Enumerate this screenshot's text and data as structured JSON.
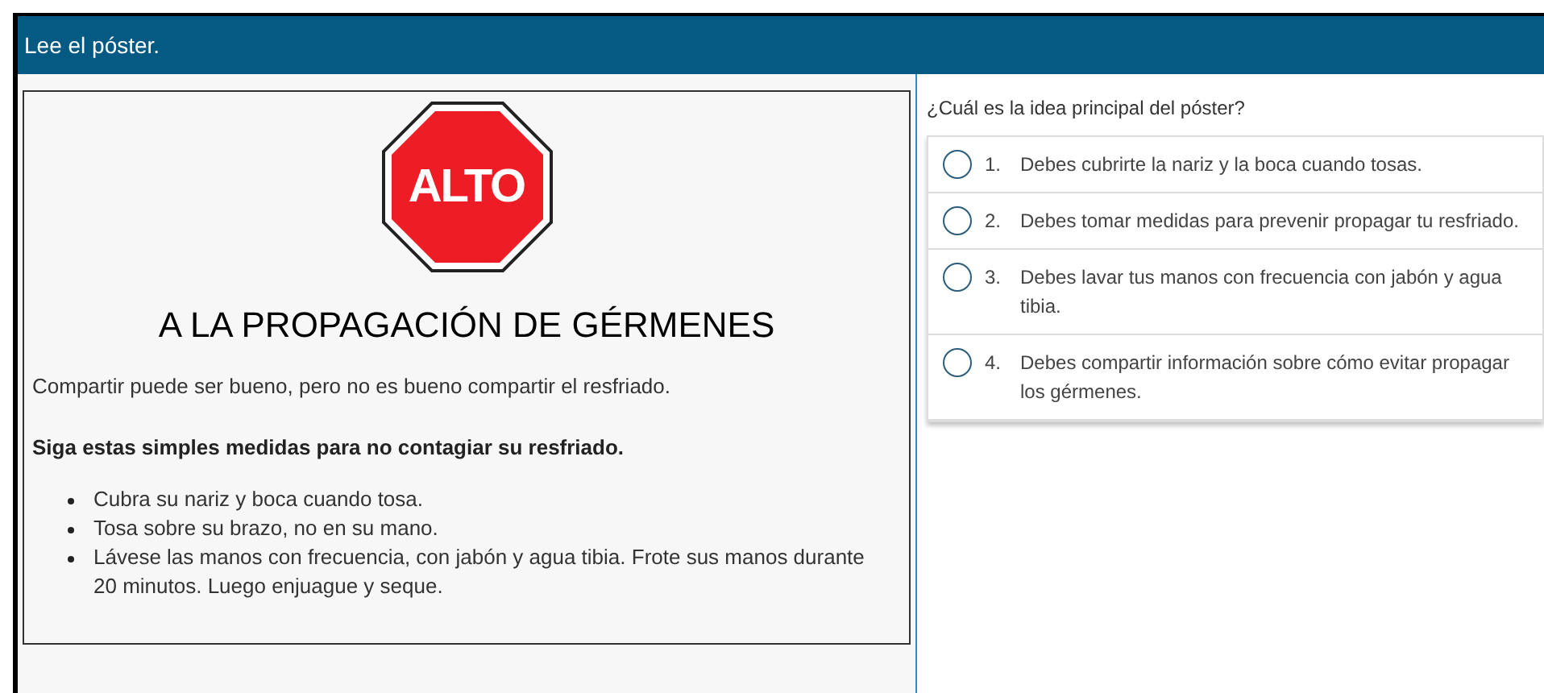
{
  "header": {
    "title": "Lee el póster."
  },
  "poster": {
    "sign_text": "ALTO",
    "heading": "A LA PROPAGACIÓN DE GÉRMENES",
    "intro": "Compartir puede ser bueno, pero no es bueno compartir el resfriado.",
    "subheading": "Siga estas simples medidas para no contagiar su resfriado.",
    "bullets": [
      "Cubra su nariz y boca cuando tosa.",
      "Tosa sobre su brazo, no en su mano.",
      "Lávese las manos con frecuencia, con jabón y agua tibia. Frote sus manos durante 20 minutos. Luego enjuague y seque."
    ]
  },
  "question": {
    "prompt": "¿Cuál es la idea principal del póster?",
    "options": [
      {
        "number": "1.",
        "text": "Debes cubrirte la nariz y la boca cuando tosas.",
        "selected": false
      },
      {
        "number": "2.",
        "text": "Debes tomar medidas para prevenir propagar tu resfriado.",
        "selected": false
      },
      {
        "number": "3.",
        "text": "Debes lavar tus manos con frecuencia con jabón y agua tibia.",
        "selected": false
      },
      {
        "number": "4.",
        "text": "Debes compartir información sobre cómo evitar propagar los gérmenes.",
        "selected": false
      }
    ]
  }
}
